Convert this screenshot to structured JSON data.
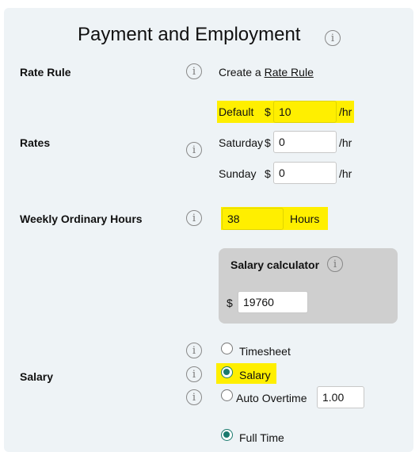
{
  "title": "Payment and Employment",
  "rate_rule": {
    "label": "Rate Rule",
    "text": "Create a ",
    "link": "Rate Rule"
  },
  "rates": {
    "label": "Rates",
    "currency": "$",
    "unit": "/hr",
    "rows": [
      {
        "name": "Default",
        "value": "10"
      },
      {
        "name": "Saturday",
        "value": "0"
      },
      {
        "name": "Sunday",
        "value": "0"
      }
    ]
  },
  "weekly_hours": {
    "label": "Weekly Ordinary Hours",
    "value": "38",
    "unit": "Hours"
  },
  "salary_calculator": {
    "title": "Salary calculator",
    "currency": "$",
    "value": "19760"
  },
  "salary": {
    "label": "Salary",
    "options": [
      {
        "label": "Timesheet",
        "selected": false
      },
      {
        "label": "Salary",
        "selected": true
      },
      {
        "label": "Auto Overtime",
        "selected": false
      }
    ],
    "overtime_value": "1.00"
  },
  "employment": {
    "option": "Full Time",
    "selected": true
  },
  "colors": {
    "highlight": "#ffef00",
    "panel": "#eef3f6",
    "radio_accent": "#1a7a6e"
  },
  "icons": {
    "info": "info-icon"
  }
}
